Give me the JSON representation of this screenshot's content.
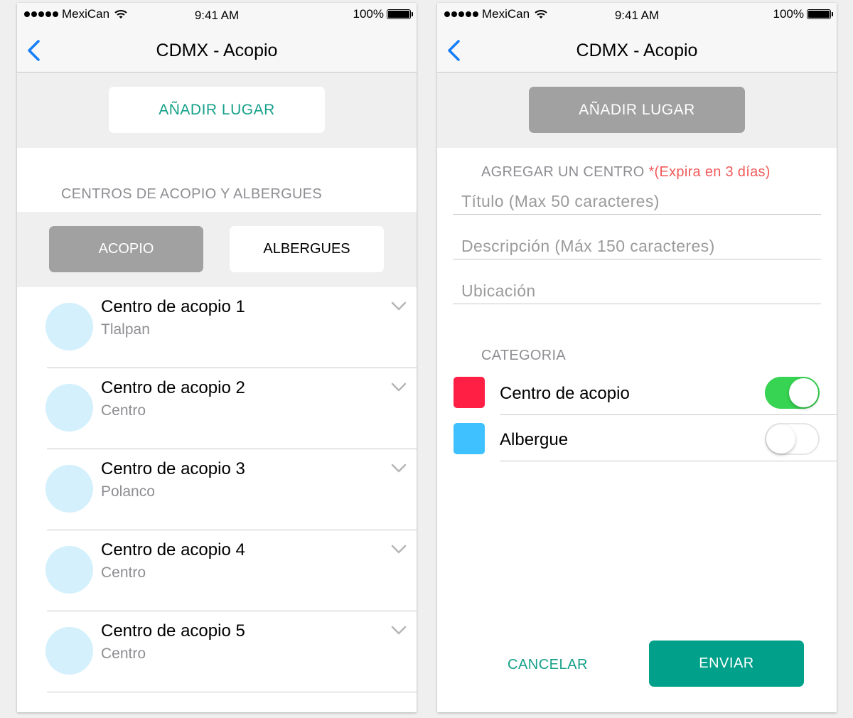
{
  "status_bar": {
    "carrier": "MexiCan",
    "time": "9:41 AM",
    "battery": "100%"
  },
  "left_screen": {
    "nav_title": "CDMX - Acopio",
    "add_place_label": "AÑADIR LUGAR",
    "section_label": "CENTROS DE ACOPIO Y ALBERGUES",
    "segments": {
      "active": "ACOPIO",
      "inactive": "ALBERGUES"
    },
    "items": [
      {
        "title": "Centro de acopio 1",
        "subtitle": "Tlalpan"
      },
      {
        "title": "Centro de acopio 2",
        "subtitle": "Centro"
      },
      {
        "title": "Centro de acopio 3",
        "subtitle": "Polanco"
      },
      {
        "title": "Centro de acopio 4",
        "subtitle": "Centro"
      },
      {
        "title": "Centro de acopio 5",
        "subtitle": "Centro"
      }
    ]
  },
  "right_screen": {
    "nav_title": "CDMX - Acopio",
    "add_place_label": "AÑADIR LUGAR",
    "form_heading": "AGREGAR UN CENTRO",
    "expire_note": "*(Expira en 3 días)",
    "fields": {
      "title_placeholder": "Título (Max 50 caracteres)",
      "description_placeholder": "Descripción (Máx 150 caracteres)",
      "location_placeholder": "Ubicación"
    },
    "category_heading": "CATEGORIA",
    "categories": [
      {
        "label": "Centro de acopio",
        "color": "#ff1f44",
        "enabled": true
      },
      {
        "label": "Albergue",
        "color": "#3fc0ff",
        "enabled": false
      }
    ],
    "cancel_label": "CANCELAR",
    "send_label": "ENVIAR"
  },
  "colors": {
    "accent_teal": "#00a08a",
    "ios_blue": "#147efb",
    "toggle_on": "#37d352",
    "expire_red": "#f25a5a"
  },
  "icons": {
    "back": "chevron-left-icon",
    "expand": "chevron-down-icon",
    "wifi": "wifi-icon",
    "battery": "battery-icon",
    "signal": "signal-dots-icon"
  }
}
